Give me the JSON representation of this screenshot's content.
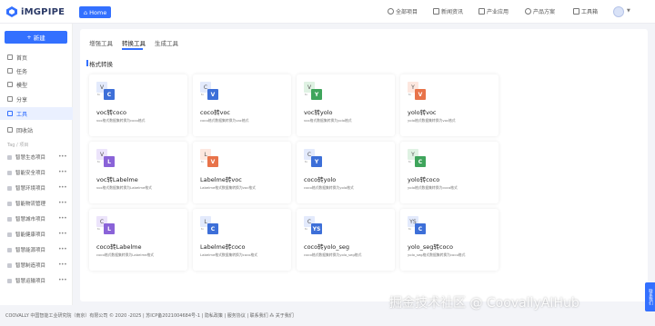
{
  "header": {
    "logo_text": "iMGPIPE",
    "home_label": "Home",
    "nav": [
      {
        "icon": "clock-icon",
        "label": "全部项目"
      },
      {
        "icon": "document-icon",
        "label": "新闻资讯"
      },
      {
        "icon": "chart-icon",
        "label": "产业应用"
      },
      {
        "icon": "bulb-icon",
        "label": "产品方案"
      },
      {
        "icon": "grid-icon",
        "label": "工具箱"
      }
    ]
  },
  "sidebar": {
    "new_label": "新建",
    "items": [
      {
        "label": "首页",
        "active": false
      },
      {
        "label": "任务",
        "active": false
      },
      {
        "label": "模型",
        "active": false
      },
      {
        "label": "分享",
        "active": false
      },
      {
        "label": "工具",
        "active": true
      },
      {
        "label": "回收站",
        "active": false
      }
    ],
    "tag_label": "Tag / 项目",
    "projects": [
      "智慧生态项目",
      "智能安全项目",
      "智慧环境项目",
      "智能物流管理",
      "智慧城市项目",
      "智能健康项目",
      "智慧能源项目",
      "智慧制造项目",
      "智慧运输项目"
    ]
  },
  "tabs": [
    {
      "label": "增强工具",
      "active": false
    },
    {
      "label": "转换工具",
      "active": true
    },
    {
      "label": "生成工具",
      "active": false
    }
  ],
  "section_title": "格式转换",
  "cards": [
    {
      "from": "V",
      "to": "C",
      "from_color": "#e3eafc",
      "to_color": "#3d6fd8",
      "title": "voc转coco",
      "desc": "voc格式数据集转换为coco格式"
    },
    {
      "from": "C",
      "to": "V",
      "from_color": "#e3eafc",
      "to_color": "#3d6fd8",
      "title": "coco转voc",
      "desc": "coco格式数据集转换为voc格式"
    },
    {
      "from": "V",
      "to": "Y",
      "from_color": "#dff2e3",
      "to_color": "#3fa55c",
      "title": "voc转yolo",
      "desc": "voc格式数据集转换为yolo格式"
    },
    {
      "from": "Y",
      "to": "V",
      "from_color": "#fde7df",
      "to_color": "#e8734a",
      "title": "yolo转voc",
      "desc": "yolo格式数据集转换为voc格式"
    },
    {
      "from": "V",
      "to": "L",
      "from_color": "#ece4fb",
      "to_color": "#8a63d8",
      "title": "voc转Labelme",
      "desc": "voc格式数据集转换为Labelme格式"
    },
    {
      "from": "L",
      "to": "V",
      "from_color": "#fde7df",
      "to_color": "#e8734a",
      "title": "Labelme转voc",
      "desc": "Labelme格式数据集转换为voc格式"
    },
    {
      "from": "C",
      "to": "Y",
      "from_color": "#e3eafc",
      "to_color": "#3d6fd8",
      "title": "coco转yolo",
      "desc": "coco格式数据集转换为yolo格式"
    },
    {
      "from": "Y",
      "to": "C",
      "from_color": "#dff2e3",
      "to_color": "#3fa55c",
      "title": "yolo转coco",
      "desc": "yolo格式数据集转换为coco格式"
    },
    {
      "from": "C",
      "to": "L",
      "from_color": "#ece4fb",
      "to_color": "#8a63d8",
      "title": "coco转Labelme",
      "desc": "coco格式数据集转换为Labelme格式"
    },
    {
      "from": "L",
      "to": "C",
      "from_color": "#e3eafc",
      "to_color": "#3d6fd8",
      "title": "Labelme转coco",
      "desc": "Labelme格式数据集转换为coco格式"
    },
    {
      "from": "C",
      "to": "YS",
      "from_color": "#e3eafc",
      "to_color": "#3d6fd8",
      "title": "coco转yolo_seg",
      "desc": "coco格式数据集转换为yolo_seg格式"
    },
    {
      "from": "YS",
      "to": "C",
      "from_color": "#e3eafc",
      "to_color": "#3d6fd8",
      "title": "yolo_seg转coco",
      "desc": "yolo_seg格式数据集转换为coco格式"
    }
  ],
  "card_to_text": "to",
  "footer": "COOVALLY  中国智能工业研究院（南京）有限公司 © 2020 -2025 | 苏ICP备2021004684号-1 | 隐私政策 | 服务协议 | 联系我们 ⁂ 关于我们",
  "float_button": "联系我们",
  "watermark": "掘金技术社区 @ CoovallyAIHub"
}
